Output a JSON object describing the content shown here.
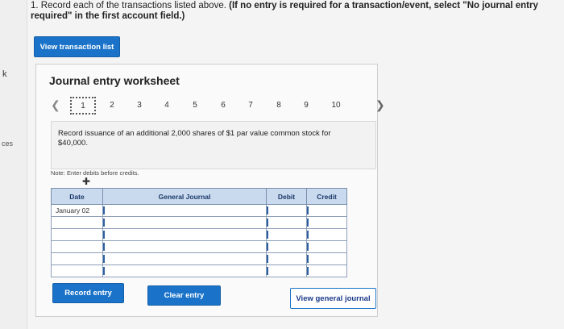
{
  "gutter": {
    "k": "k",
    "ces": "ces"
  },
  "question": {
    "prefix": "1. Record each of the transactions listed above. ",
    "bold": "(If no entry is required for a transaction/event, select \"No journal entry required\" in the first account field.)"
  },
  "buttons": {
    "view_transaction_list": "View transaction list",
    "record_entry": "Record entry",
    "clear_entry": "Clear entry",
    "view_general_journal": "View general journal"
  },
  "worksheet": {
    "title": "Journal entry worksheet",
    "pages": [
      "1",
      "2",
      "3",
      "4",
      "5",
      "6",
      "7",
      "8",
      "9",
      "10"
    ],
    "active_page": "1",
    "description": "Record issuance of an additional 2,000 shares of $1 par value common stock for $40,000.",
    "note": "Note: Enter debits before credits."
  },
  "journal": {
    "headers": {
      "date": "Date",
      "general_journal": "General Journal",
      "debit": "Debit",
      "credit": "Credit"
    },
    "rows": [
      {
        "date": "January 02"
      },
      {
        "date": ""
      },
      {
        "date": ""
      },
      {
        "date": ""
      },
      {
        "date": ""
      },
      {
        "date": ""
      }
    ]
  },
  "icons": {
    "prev": "chevron-left-icon",
    "next": "chevron-right-icon",
    "cursor": "plus-cursor-icon"
  }
}
